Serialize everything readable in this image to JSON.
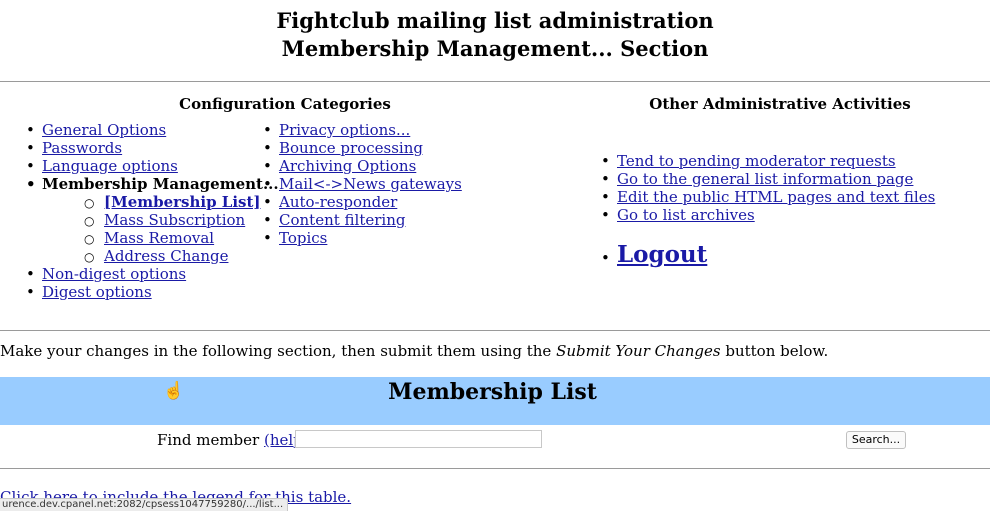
{
  "header": {
    "title_line1": "Fightclub mailing list administration",
    "title_line2": "Membership Management... Section"
  },
  "config": {
    "heading": "Configuration Categories",
    "left": [
      {
        "label": "General Options",
        "link": true
      },
      {
        "label": "Passwords",
        "link": true
      },
      {
        "label": "Language options",
        "link": true
      },
      {
        "label": "Membership Management...",
        "link": false,
        "bold": true
      },
      {
        "label": "[Membership List]",
        "link": true,
        "sub": true,
        "current": true
      },
      {
        "label": "Mass Subscription",
        "link": true,
        "sub": true
      },
      {
        "label": "Mass Removal",
        "link": true,
        "sub": true
      },
      {
        "label": "Address Change",
        "link": true,
        "sub": true
      },
      {
        "label": "Non-digest options",
        "link": true
      },
      {
        "label": "Digest options",
        "link": true
      }
    ],
    "right": [
      {
        "label": "Privacy options..."
      },
      {
        "label": "Bounce processing"
      },
      {
        "label": "Archiving Options"
      },
      {
        "label": "Mail<->News gateways"
      },
      {
        "label": "Auto-responder"
      },
      {
        "label": "Content filtering"
      },
      {
        "label": "Topics"
      }
    ]
  },
  "other": {
    "heading": "Other Administrative Activities",
    "items": [
      {
        "label": "Tend to pending moderator requests"
      },
      {
        "label": "Go to the general list information page"
      },
      {
        "label": "Edit the public HTML pages and text files"
      },
      {
        "label": "Go to list archives"
      }
    ],
    "logout": "Logout"
  },
  "instructions": {
    "before": "Make your changes in the following section, then submit them using the ",
    "emphasis": "Submit Your Changes",
    "after": " button below."
  },
  "section": {
    "title": "Membership List",
    "find_label": "Find member ",
    "help_link": "(help)",
    "colon": ":",
    "search_value": "",
    "search_button": "Search...",
    "legend_link": "Click here to include the legend for this table."
  },
  "status_bar": {
    "url": "urence.dev.cpanel.net:2082/cpsess1047759280/.../list..."
  },
  "colors": {
    "link": "#1a1aa6",
    "section_bar": "#99ccff",
    "rule": "#9a9a9a"
  }
}
